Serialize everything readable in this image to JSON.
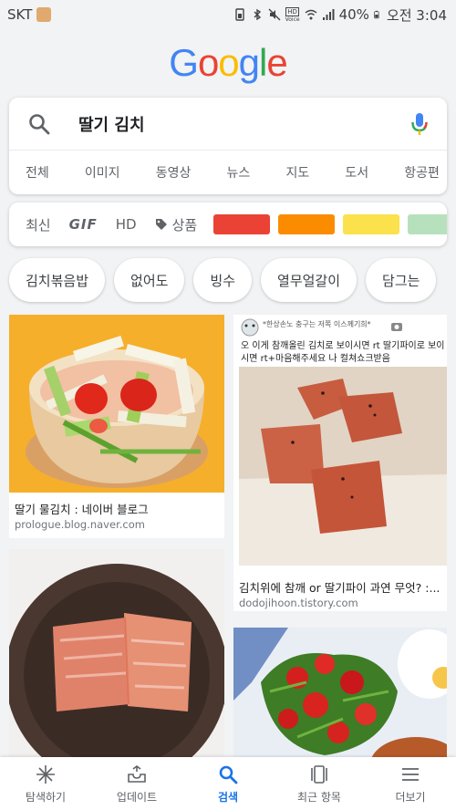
{
  "status_bar": {
    "carrier": "SKT",
    "battery": "40%",
    "time": "오전 3:04",
    "hd_label": "HD",
    "voice_label": "Voice"
  },
  "logo": {
    "text": "Google",
    "colors": [
      "#4285F4",
      "#EA4335",
      "#FBBC05",
      "#4285F4",
      "#34A853",
      "#EA4335"
    ]
  },
  "search": {
    "query": "딸기 김치",
    "tabs": [
      "전체",
      "이미지",
      "동영상",
      "뉴스",
      "지도",
      "도서",
      "항공편"
    ]
  },
  "filters": {
    "latest": "최신",
    "gif": "GIF",
    "hd": "HD",
    "product": "상품",
    "color_swatches": [
      "#ea4335",
      "#fb8c00",
      "#fbe14b",
      "#b7e1bd"
    ]
  },
  "chips": [
    "김치볶음밥",
    "없어도",
    "빙수",
    "열무얼갈이",
    "담그는"
  ],
  "results": [
    {
      "title": "딸기 물김치 : 네이버 블로그",
      "domain": "prologue.blog.naver.com"
    },
    {
      "title": "김치위에 참깨 or 딸기파이 과연 무엇? :...",
      "domain": "dodojihoon.tistory.com",
      "overlay_caption": "오 이게 참깨올린 김치로 보이시면 rt 딸기파이로 보이시면 rt+마음해주세요 나 컬쳐쇼크받음",
      "overlay_header": "*한상손노 충구는 저쪽 이스께기희*"
    },
    {
      "title": "",
      "domain": ""
    },
    {
      "title": "",
      "domain": ""
    }
  ],
  "bottom_nav": [
    {
      "label": "탐색하기",
      "icon": "asterisk-icon"
    },
    {
      "label": "업데이트",
      "icon": "updates-tray-icon"
    },
    {
      "label": "검색",
      "icon": "search-icon",
      "active": true
    },
    {
      "label": "최근 항목",
      "icon": "recent-cards-icon"
    },
    {
      "label": "더보기",
      "icon": "menu-icon"
    }
  ]
}
